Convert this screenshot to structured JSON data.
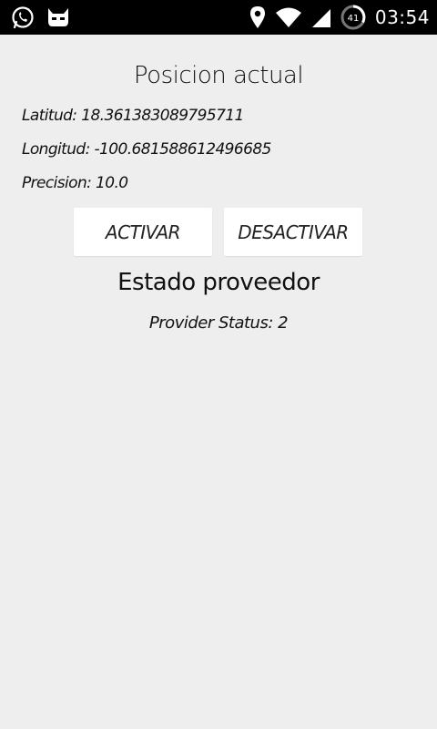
{
  "status_bar": {
    "time": "03:54",
    "battery_level": "41",
    "left_icons": [
      "whatsapp-icon",
      "cyanogen-mascot-icon"
    ],
    "right_icons": [
      "location-pin-icon",
      "wifi-icon",
      "signal-icon",
      "battery-circle-icon"
    ]
  },
  "main": {
    "title": "Posicion actual",
    "latitud": "Latitud: 18.361383089795711",
    "longitud": "Longitud: -100.681588612496685",
    "precision": "Precision: 10.0",
    "activar_label": "ACTIVAR",
    "desactivar_label": "DESACTIVAR",
    "estado_title": "Estado proveedor",
    "provider_status": "Provider Status: 2"
  },
  "colors": {
    "background": "#eeeeee",
    "status_bar": "#000000",
    "button": "#ffffff",
    "text": "#111111"
  }
}
